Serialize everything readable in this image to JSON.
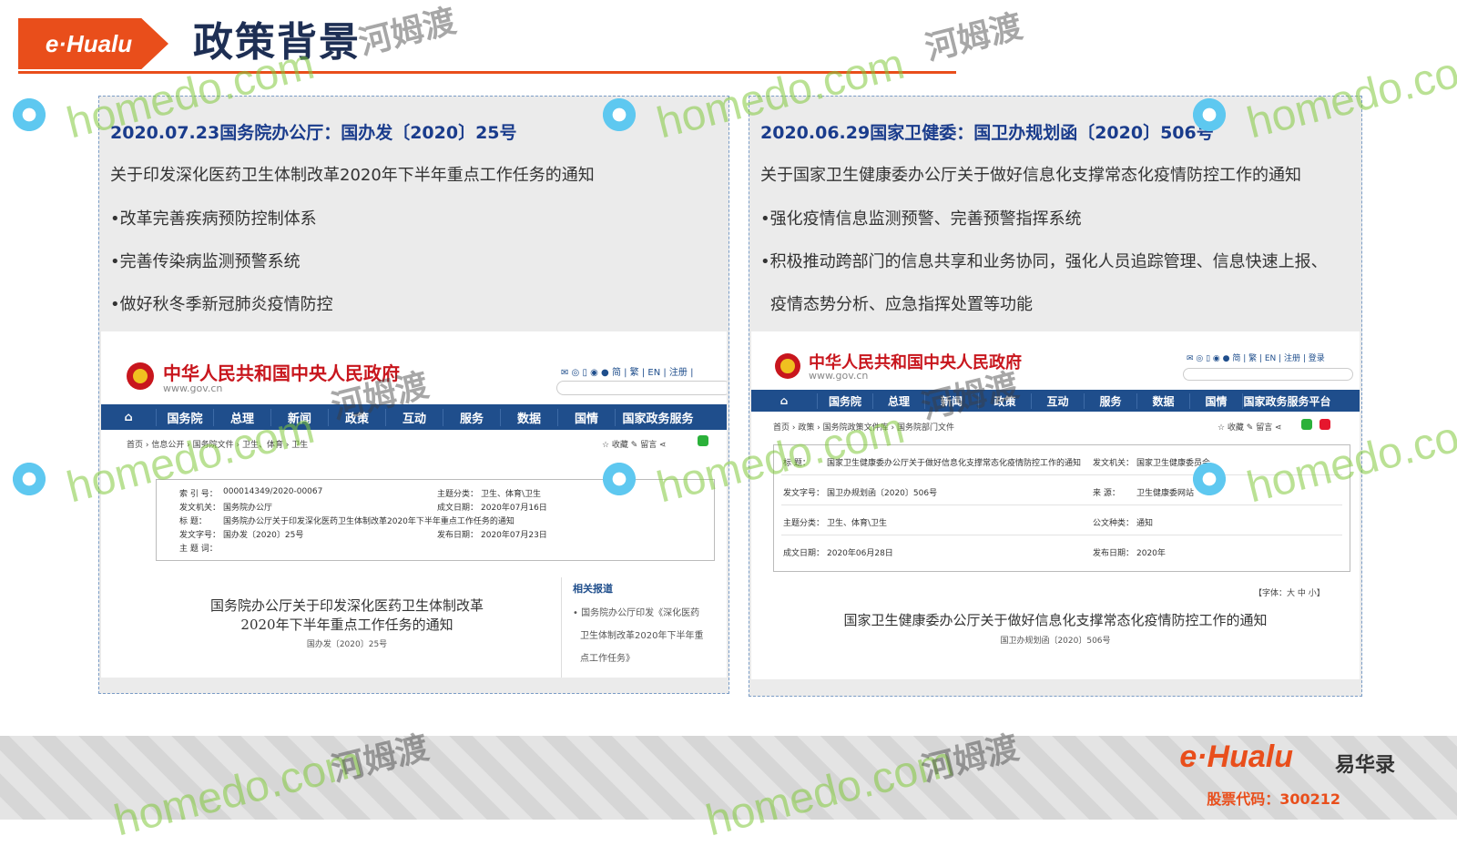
{
  "header": {
    "logo": "e·Hualu",
    "title": "政策背景"
  },
  "left_panel": {
    "heading": "2020.07.23国务院办公厅：国办发〔2020〕25号",
    "subtitle": "关于印发深化医药卫生体制改革2020年下半年重点工作任务的通知",
    "bullets": [
      "•改革完善疾病预防控制体系",
      "•完善传染病监测预警系统",
      "•做好秋冬季新冠肺炎疫情防控"
    ],
    "screenshot": {
      "site_name": "中华人民共和国中央人民政府",
      "site_url": "www.gov.cn",
      "toolbar": "✉ ◎ ▯ ◉ ● 简 | 繁 | EN | 注册 |",
      "nav": [
        "国务院",
        "总理",
        "新闻",
        "政策",
        "互动",
        "服务",
        "数据",
        "国情",
        "国家政务服务"
      ],
      "breadcrumb": "首页 › 信息公开 › 国务院文件 › 卫生、体育 › 卫生",
      "share": "☆ 收藏   ✎ 留言   ⋖",
      "meta": [
        {
          "label": "索 引 号：",
          "value": "000014349/2020-00067",
          "label2": "主题分类：",
          "value2": "卫生、体育\\卫生"
        },
        {
          "label": "发文机关：",
          "value": "国务院办公厅",
          "label2": "成文日期：",
          "value2": "2020年07月16日"
        },
        {
          "label": "标    题：",
          "value": "国务院办公厅关于印发深化医药卫生体制改革2020年下半年重点工作任务的通知",
          "label2": "",
          "value2": ""
        },
        {
          "label": "发文字号：",
          "value": "国办发〔2020〕25号",
          "label2": "发布日期：",
          "value2": "2020年07月23日"
        },
        {
          "label": "主 题 词：",
          "value": "",
          "label2": "",
          "value2": ""
        }
      ],
      "doc_title_line1": "国务院办公厅关于印发深化医药卫生体制改革",
      "doc_title_line2": "2020年下半年重点工作任务的通知",
      "doc_no": "国办发〔2020〕25号",
      "related_title": "相关报道",
      "related_lines": [
        "• 国务院办公厅印发《深化医药",
        "卫生体制改革2020年下半年重",
        "点工作任务》"
      ]
    }
  },
  "right_panel": {
    "heading": "2020.06.29国家卫健委：国卫办规划函〔2020〕506号",
    "subtitle": "关于国家卫生健康委办公厅关于做好信息化支撑常态化疫情防控工作的通知",
    "bullets": [
      "•强化疫情信息监测预警、完善预警指挥系统",
      "•积极推动跨部门的信息共享和业务协同，强化人员追踪管理、信息快速上报、",
      "疫情态势分析、应急指挥处置等功能"
    ],
    "screenshot": {
      "site_name": "中华人民共和国中央人民政府",
      "site_url": "www.gov.cn",
      "toolbar": "✉ ◎ ▯ ◉ ● 简 | 繁 | EN | 注册 | 登录",
      "nav": [
        "国务院",
        "总理",
        "新闻",
        "政策",
        "互动",
        "服务",
        "数据",
        "国情",
        "国家政务服务平台"
      ],
      "breadcrumb": "首页 › 政策 › 国务院政策文件库 › 国务院部门文件",
      "share": "☆ 收藏   ✎ 留言   ⋖",
      "meta": [
        {
          "label": "标    题：",
          "value": "国家卫生健康委办公厅关于做好信息化支撑常态化疫情防控工作的通知",
          "label2": "发文机关：",
          "value2": "国家卫生健康委员会"
        },
        {
          "label": "发文字号：",
          "value": "国卫办规划函〔2020〕506号",
          "label2": "来    源：",
          "value2": "卫生健康委网站"
        },
        {
          "label": "主题分类：",
          "value": "卫生、体育\\卫生",
          "label2": "公文种类：",
          "value2": "通知"
        },
        {
          "label": "成文日期：",
          "value": "2020年06月28日",
          "label2": "发布日期：",
          "value2": "2020年"
        }
      ],
      "font_size": "【字体：大 中 小】",
      "doc_title": "国家卫生健康委办公厅关于做好信息化支撑常态化疫情防控工作的通知",
      "doc_no": "国卫办规划函〔2020〕506号"
    }
  },
  "watermark": {
    "latin": "homedo.com",
    "cn": "河姆渡"
  },
  "footer": {
    "logo": "e·Hualu",
    "logo_cn": "易华录",
    "stock": "股票代码：300212"
  },
  "colors": {
    "brand_orange": "#e94e1b",
    "title_navy": "#1e2f54",
    "heading_blue": "#1a3c8c",
    "gov_red": "#c8161d",
    "gov_nav_blue": "#1f4e8c"
  }
}
